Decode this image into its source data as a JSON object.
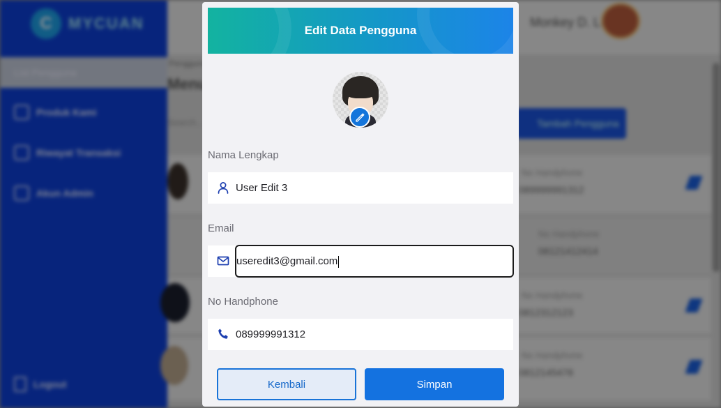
{
  "background": {
    "brand": {
      "logo_letter": "C",
      "name": "MYCUAN"
    },
    "sidebar": {
      "active_item": "List Pengguna",
      "items": [
        "Produk Kami",
        "Riwayat Transaksi",
        "Akun Admin"
      ],
      "logout": "Logout"
    },
    "header": {
      "user_name": "Monkey D. Luffy"
    },
    "breadcrumb": "Pengguna",
    "page_title": "Menu Pengguna",
    "search_placeholder": "Search...",
    "add_button": "Tambah Pengguna",
    "rows": [
      {
        "phone_label": "No Handphone",
        "phone": "089999991312"
      },
      {
        "phone_label": "No Handphone",
        "phone": "08121412414"
      },
      {
        "phone_label": "No Handphone",
        "phone": "0812312123"
      },
      {
        "phone_label": "No Handphone",
        "phone": "0812145478"
      }
    ]
  },
  "modal": {
    "title": "Edit Data Pengguna",
    "fields": {
      "name": {
        "label": "Nama Lengkap",
        "value": "User Edit 3",
        "icon": "user-icon"
      },
      "email": {
        "label": "Email",
        "value": "useredit3@gmail.com",
        "icon": "mail-icon"
      },
      "phone": {
        "label": "No Handphone",
        "value": "089999991312",
        "icon": "phone-icon"
      }
    },
    "buttons": {
      "back": "Kembali",
      "save": "Simpan"
    }
  },
  "colors": {
    "sidebar": "#0d3fd6",
    "header_gradient_start": "#13b3a0",
    "header_gradient_end": "#1c84e8",
    "primary": "#1472e0",
    "icon": "#1d3fb0"
  }
}
